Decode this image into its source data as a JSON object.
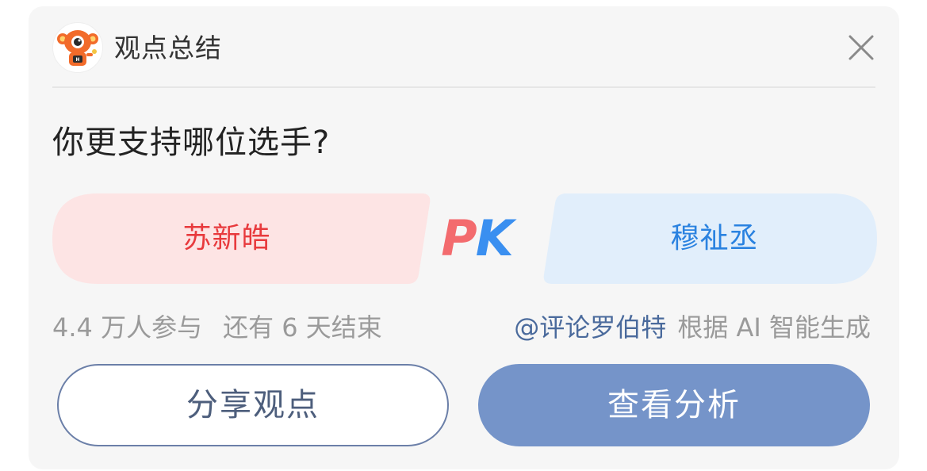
{
  "header": {
    "title": "观点总结",
    "avatar_icon": "robot-mascot-icon",
    "close_icon": "close-icon"
  },
  "question": "你更支持哪位选手?",
  "vote": {
    "left_option": "苏新皓",
    "right_option": "穆祉丞",
    "vs_label_p": "P",
    "vs_label_k": "K",
    "colors": {
      "left_bg": "#fde4e4",
      "left_text": "#e83a3d",
      "right_bg": "#e1eefb",
      "right_text": "#2a82e0"
    }
  },
  "meta": {
    "participants": "4.4 万人参与",
    "remaining": "还有 6 天结束",
    "author": "@评论罗伯特",
    "source": "根据 AI 智能生成"
  },
  "actions": {
    "share_label": "分享观点",
    "analysis_label": "查看分析"
  }
}
